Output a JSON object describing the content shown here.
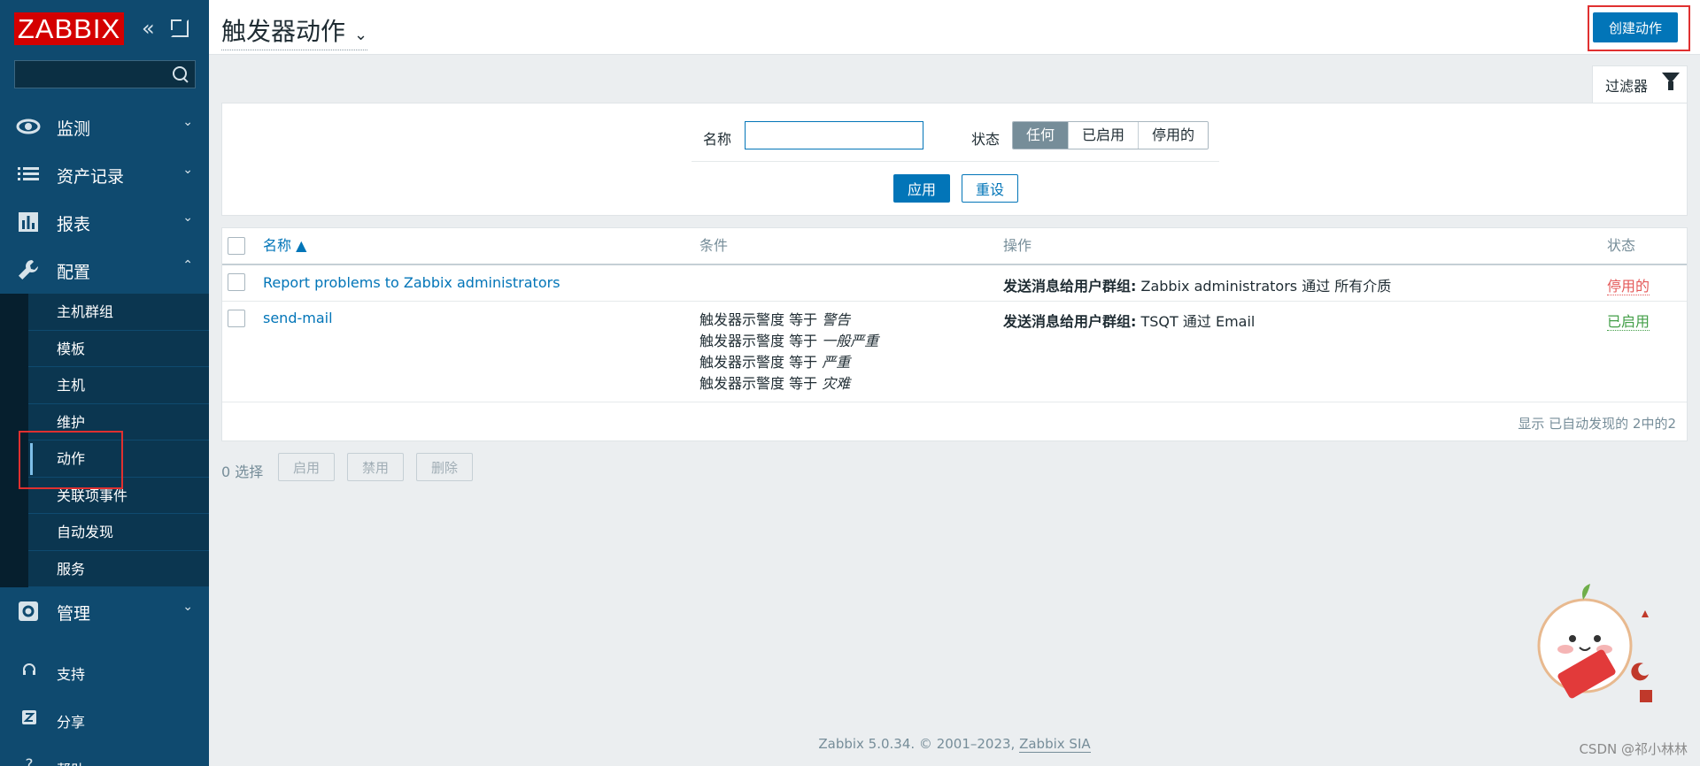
{
  "app": {
    "logo_text": "ZABBIX",
    "title": "触发器动作",
    "create_button": "创建动作"
  },
  "sidebar": {
    "search": {
      "value": "",
      "placeholder": ""
    },
    "menu": [
      {
        "label": "监测",
        "icon": "eye-icon",
        "expanded": false
      },
      {
        "label": "资产记录",
        "icon": "list-icon",
        "expanded": false
      },
      {
        "label": "报表",
        "icon": "bar-chart-icon",
        "expanded": false
      },
      {
        "label": "配置",
        "icon": "wrench-icon",
        "expanded": true
      },
      {
        "label": "管理",
        "icon": "gear-icon",
        "expanded": false
      }
    ],
    "config_submenu": [
      "主机群组",
      "模板",
      "主机",
      "维护",
      "动作",
      "关联项事件",
      "自动发现",
      "服务"
    ],
    "active_submenu": "动作",
    "bottom": [
      {
        "label": "支持",
        "icon": "headset-icon"
      },
      {
        "label": "分享",
        "icon": "share-icon"
      },
      {
        "label": "帮助",
        "icon": "help-icon"
      }
    ]
  },
  "filter": {
    "tab_label": "过滤器",
    "name_label": "名称",
    "name_value": "",
    "status_label": "状态",
    "status_options": [
      "任何",
      "已启用",
      "停用的"
    ],
    "status_selected": "任何",
    "apply": "应用",
    "reset": "重设"
  },
  "table": {
    "headers": {
      "name": "名称 ▲",
      "conditions": "条件",
      "operations": "操作",
      "status": "状态"
    },
    "rows": [
      {
        "name": "Report problems to Zabbix administrators",
        "conditions": [],
        "operation_label": "发送消息给用户群组:",
        "operation_value": " Zabbix administrators 通过 所有介质",
        "status": "停用的"
      },
      {
        "name": "send-mail",
        "conditions": [
          {
            "prefix": "触发器示警度 等于 ",
            "value": "警告"
          },
          {
            "prefix": "触发器示警度 等于 ",
            "value": "一般严重"
          },
          {
            "prefix": "触发器示警度 等于 ",
            "value": "严重"
          },
          {
            "prefix": "触发器示警度 等于 ",
            "value": "灾难"
          }
        ],
        "operation_label": "发送消息给用户群组:",
        "operation_value": " TSQT 通过 Email",
        "status": "已启用"
      }
    ],
    "footer": "显示 已自动发现的 2中的2"
  },
  "actions": {
    "selected": "0 选择",
    "enable": "启用",
    "disable": "禁用",
    "delete": "删除"
  },
  "footer": {
    "text": "Zabbix 5.0.34. © 2001–2023, ",
    "link": "Zabbix SIA"
  },
  "watermark": "CSDN @祁小林林",
  "colors": {
    "sidebar_bg": "#0f4a6f",
    "primary": "#0275b8",
    "logo_red": "#d40000",
    "disabled_red": "#e45959",
    "enabled_green": "#429e47"
  }
}
